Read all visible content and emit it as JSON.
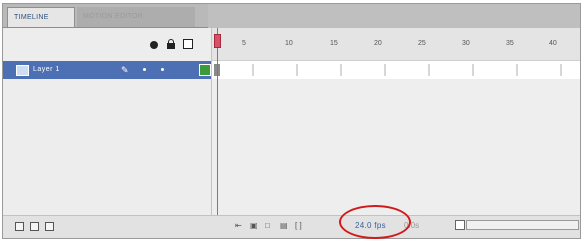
{
  "tabs": [
    {
      "label": "TIMELINE",
      "active": true
    },
    {
      "label": "MOTION EDITOR",
      "active": false
    }
  ],
  "header_icons": [
    "eye-icon",
    "lock-icon",
    "outline-icon"
  ],
  "layer": {
    "name": "Layer 1",
    "icon": "layer-icon",
    "color": "#3b9a3a"
  },
  "ruler": {
    "labels": [
      "5",
      "10",
      "15",
      "20",
      "25",
      "30",
      "35",
      "40"
    ]
  },
  "bottom": {
    "buttons": [
      "new-layer-icon",
      "new-folder-icon",
      "delete-icon"
    ],
    "frame_rate": "24.0 fps",
    "fps_unit": "0.0s"
  },
  "colors": {
    "selected_row": "#4d6fb3",
    "playhead": "#d9506a",
    "highlight": "#d11a1a"
  }
}
